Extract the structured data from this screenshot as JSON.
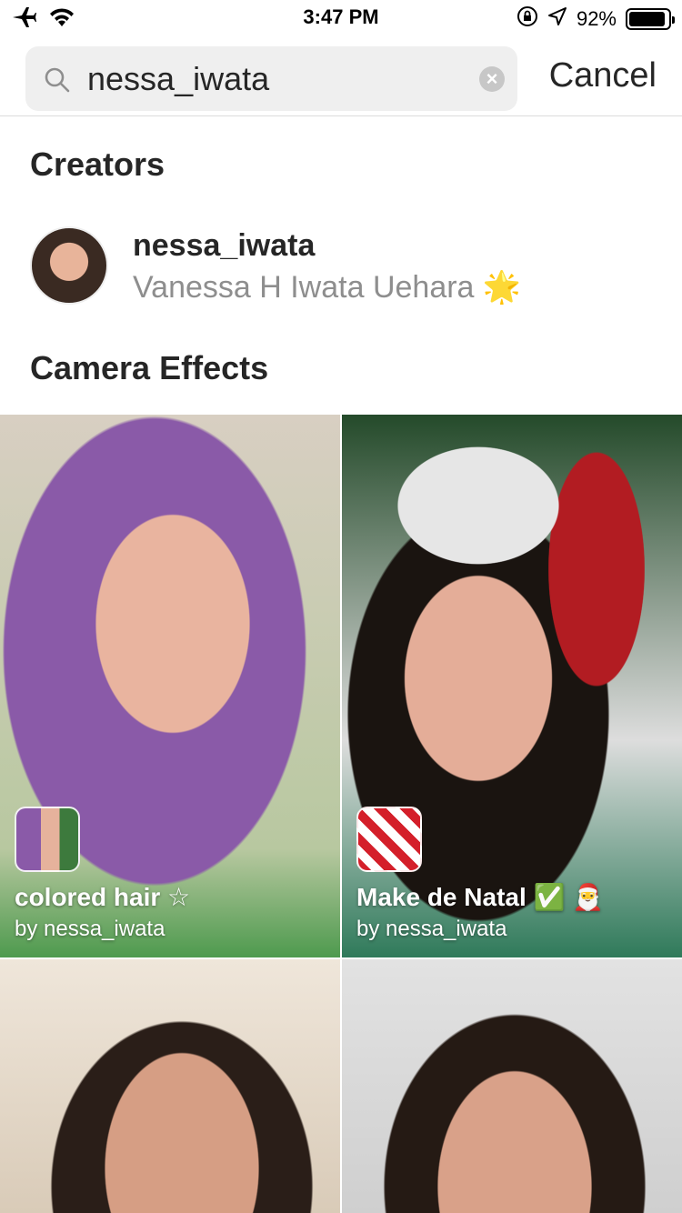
{
  "status_bar": {
    "time": "3:47 PM",
    "battery_percent": "92%",
    "battery_level": 0.92,
    "icons": [
      "airplane-icon",
      "wifi-icon",
      "orientation-lock-icon",
      "location-icon",
      "battery-icon"
    ]
  },
  "search": {
    "query": "nessa_iwata",
    "cancel_label": "Cancel"
  },
  "sections": {
    "creators_title": "Creators",
    "effects_title": "Camera Effects"
  },
  "creator": {
    "username": "nessa_iwata",
    "full_name": "Vanessa H Iwata Uehara 🌟"
  },
  "effects": [
    {
      "title": "colored hair ☆",
      "by": "by nessa_iwata"
    },
    {
      "title": "Make de Natal ✅ 🎅",
      "by": "by nessa_iwata"
    },
    {
      "title": "",
      "by": ""
    },
    {
      "title": "",
      "by": ""
    }
  ]
}
